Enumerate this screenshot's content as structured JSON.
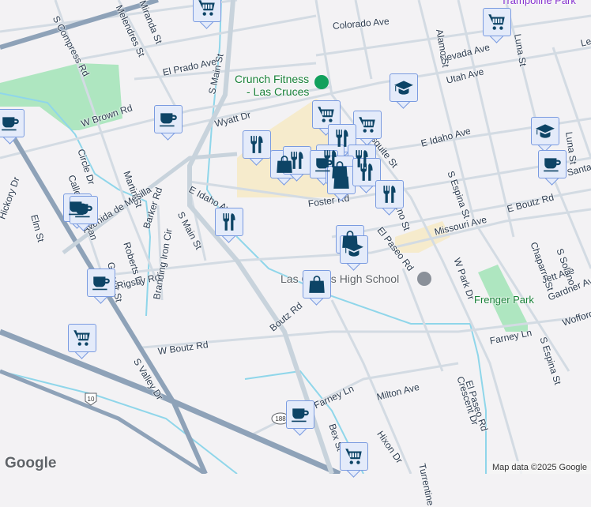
{
  "map": {
    "colors": {
      "background": "#f3f2f4",
      "road": "#d3dbe3",
      "highway": "#8ea2b8",
      "water": "#8fd6ea",
      "park": "#aee6c0",
      "commercial": "#f6ebcc",
      "marker_fill": "#e4ebfa",
      "marker_icon": "#0d4466"
    },
    "pois": {
      "crunch_line1": "Crunch Fitness",
      "crunch_line2": "- Las Cruces",
      "high_school": "Las Cruces High School",
      "frenger_park": "Frenger Park",
      "trampoline_park": "Trampoline Park"
    },
    "streets": [
      "S Compress Rd",
      "Melendres St",
      "Miranda St",
      "El Prado Ave",
      "S Main St",
      "W Brown Rd",
      "Wyatt Dr",
      "Circle Dr",
      "Martin St",
      "Calle Del Parian",
      "E Idaho Ave",
      "Avenida de Mesilla",
      "Barker Rd",
      "Roberts Dr",
      "Grover St",
      "Rigsby Rd",
      "Branding Iron Cir",
      "Elm St",
      "Hickory Dr",
      "S Valley Dr",
      "W Boutz Rd",
      "Boutz Rd",
      "Colorado Ave",
      "Nevada Ave",
      "Alamo St",
      "Luna St",
      "Utah Ave",
      "S Mesquite St",
      "E Idaho Ave",
      "S Espina St",
      "Durazno St",
      "Foster Rd",
      "El Paseo Rd",
      "E Boutz Rd",
      "Missouri Ave",
      "W Park Dr",
      "Chaparro St",
      "Jett Ave",
      "Gardner Ave",
      "Wofford",
      "Farney Ln",
      "Crescent Dr",
      "El Paseo Rd",
      "Milton Ave",
      "Farney Ln",
      "Bex St",
      "Hixon Dr",
      "Turrentine",
      "S Solano",
      "S Main St",
      "S Espina St",
      "Luna St",
      "Santana Ave",
      "Lee"
    ],
    "shields": {
      "i10": "10",
      "nm188": "188"
    },
    "markers": [
      "cart",
      "cart",
      "coffee",
      "coffee",
      "education",
      "cart",
      "cart",
      "restaurant",
      "restaurant",
      "shopping",
      "restaurant",
      "restaurant",
      "restaurant",
      "coffee",
      "shopping",
      "shopping",
      "restaurant",
      "restaurant",
      "coffee",
      "coffee",
      "restaurant",
      "education",
      "coffee",
      "shopping",
      "education",
      "coffee",
      "shopping",
      "cart",
      "coffee",
      "cart"
    ]
  },
  "logo": "Google",
  "attribution": "Map data ©2025 Google"
}
